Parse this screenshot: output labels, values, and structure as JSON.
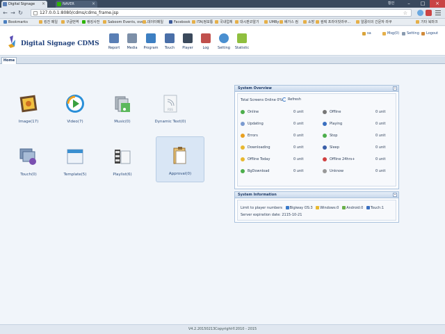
{
  "browser": {
    "tabs": [
      {
        "label": "Digital Signage",
        "active": true
      },
      {
        "label": "NAVER",
        "active": false
      }
    ],
    "window_user": "황민",
    "url": "127.0.0.1:8080/cdms/cdms_frame.jsp",
    "bookmarks": [
      "Bookmarks",
      "킹진 메일",
      "구글번역",
      "랭킹사전",
      "Saboom Events, over...",
      "데이터메일",
      "Facebook",
      "ITA(정보통",
      "국내업체",
      "대시판코알기",
      "UMBy",
      "베가스 컴",
      "소방",
      "컴텍 프라이빗라쿠...",
      "알콩이의 긴문자 라쿠",
      "기타 북마크"
    ]
  },
  "app": {
    "brand": "Digital Signage CDMS",
    "nav": [
      {
        "label": "Report",
        "icon": "report-icon",
        "color": "#5a7fb5"
      },
      {
        "label": "Media",
        "icon": "media-icon",
        "color": "#7c8fa8"
      },
      {
        "label": "Program",
        "icon": "program-icon",
        "color": "#3d7fc2"
      },
      {
        "label": "Touch",
        "icon": "touch-icon",
        "color": "#4a6fa8"
      },
      {
        "label": "Player",
        "icon": "player-icon",
        "color": "#3b4a5c"
      },
      {
        "label": "Log",
        "icon": "log-icon",
        "color": "#c0504d"
      },
      {
        "label": "Setting",
        "icon": "setting-icon",
        "color": "#4a8fd0"
      },
      {
        "label": "Statistic",
        "icon": "statistic-icon",
        "color": "#8fbf3f"
      }
    ],
    "header_links": [
      {
        "label": "sa",
        "icon": "user-icon",
        "color": "#d9a43a"
      },
      {
        "label": "Msg(0)",
        "icon": "message-icon",
        "color": "#e5b04a"
      },
      {
        "label": "Setting",
        "icon": "gear-icon",
        "color": "#8a9bb0"
      },
      {
        "label": "Logout",
        "icon": "logout-icon",
        "color": "#d08a3a"
      }
    ],
    "home_tab": "Home"
  },
  "tiles": [
    {
      "label": "Image(17)",
      "icon": "image-icon"
    },
    {
      "label": "Video(7)",
      "icon": "video-icon"
    },
    {
      "label": "Music(0)",
      "icon": "music-icon"
    },
    {
      "label": "Dynamic Text(0)",
      "icon": "rss-icon"
    },
    {
      "label": "Touch(0)",
      "icon": "touch-content-icon"
    },
    {
      "label": "Template(5)",
      "icon": "template-icon"
    },
    {
      "label": "Playlist(6)",
      "icon": "playlist-icon"
    },
    {
      "label": "Approval(0)",
      "icon": "approval-icon"
    }
  ],
  "system_overview": {
    "title": "System Overview",
    "total_online": "Total Screens Online 0%",
    "refresh": "Refresh",
    "left": [
      {
        "label": "Online",
        "count": "0 unit",
        "color": "#4cae4c"
      },
      {
        "label": "Updating",
        "count": "0 unit",
        "color": "#7a9ad0"
      },
      {
        "label": "Errors",
        "count": "0 unit",
        "color": "#e8a020"
      },
      {
        "label": "Downloading",
        "count": "0 unit",
        "color": "#e8b830"
      },
      {
        "label": "Offline Today",
        "count": "0 unit",
        "color": "#e8b830"
      },
      {
        "label": "BgDownload",
        "count": "0 unit",
        "color": "#4cae4c"
      }
    ],
    "right": [
      {
        "label": "Offline",
        "count": "0 unit",
        "color": "#777777"
      },
      {
        "label": "Playing",
        "count": "0 unit",
        "color": "#3a6fc0"
      },
      {
        "label": "Stop",
        "count": "0 unit",
        "color": "#4cae4c"
      },
      {
        "label": "Sleep",
        "count": "0 unit",
        "color": "#3a5fa8"
      },
      {
        "label": "Offline 24hrs+",
        "count": "0 unit",
        "color": "#d04040"
      },
      {
        "label": "Unknow",
        "count": "0 unit",
        "color": "#999999"
      }
    ]
  },
  "system_information": {
    "title": "System Information",
    "limit_label": "Limit to player numbers",
    "platforms": [
      {
        "label": "Bigiway OS:3",
        "color": "#3a7ac9"
      },
      {
        "label": "Windows:0",
        "color": "#e8b830"
      },
      {
        "label": "Android:0",
        "color": "#6ab04c"
      },
      {
        "label": "Touch:1",
        "color": "#3a6fc0"
      }
    ],
    "expiration": "Server expiration date: 2115-10-21"
  },
  "footer": "V4.2.20150213Copyright©2010 - 2015"
}
